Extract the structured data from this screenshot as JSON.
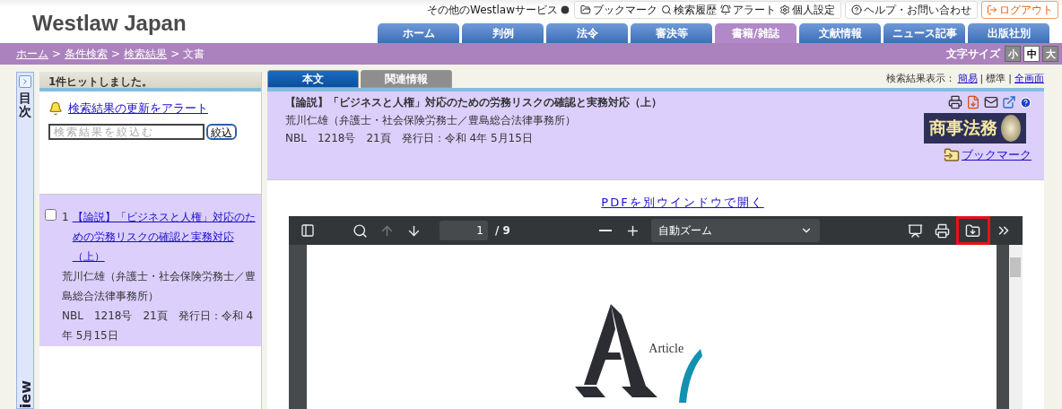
{
  "header": {
    "logo": "Westlaw Japan",
    "utility_links": [
      {
        "kind": "services",
        "label": "その他のWestlawサービス"
      },
      {
        "kind": "bookmark",
        "label": "ブックマーク"
      },
      {
        "kind": "history",
        "label": "検索履歴"
      },
      {
        "kind": "alert",
        "label": "アラート"
      },
      {
        "kind": "settings",
        "label": "個人設定"
      },
      {
        "kind": "help",
        "label": "ヘルプ・お問い合わせ"
      },
      {
        "kind": "logout",
        "label": "ログアウト"
      }
    ],
    "tabs": [
      {
        "label": "ホーム",
        "selected": false
      },
      {
        "label": "判例",
        "selected": false
      },
      {
        "label": "法令",
        "selected": false
      },
      {
        "label": "審決等",
        "selected": false
      },
      {
        "label": "書籍/雑誌",
        "selected": true
      },
      {
        "label": "文献情報",
        "selected": false
      },
      {
        "label": "ニュース記事",
        "selected": false
      },
      {
        "label": "出版社別",
        "selected": false
      }
    ]
  },
  "breadcrumb": {
    "separator": ">",
    "items": [
      {
        "label": "ホーム",
        "link": true
      },
      {
        "label": "条件検索",
        "link": true
      },
      {
        "label": "検索結果",
        "link": true
      },
      {
        "label": "文書",
        "link": false
      }
    ]
  },
  "font_size": {
    "label": "文字サイズ",
    "options": [
      {
        "label": "小",
        "selected": false
      },
      {
        "label": "中",
        "selected": true
      },
      {
        "label": "大",
        "selected": false
      }
    ]
  },
  "side_strip": {
    "toc_label": "目次",
    "bottom_label": "iew"
  },
  "results_panel": {
    "hit_count": "1件ヒットしました。",
    "alert_link": "検索結果の更新をアラート",
    "filter": {
      "placeholder": "検索結果を絞込む"
    },
    "filter_button": "絞込",
    "results": [
      {
        "checked": false,
        "number": "1",
        "title": "【論説】「ビジネスと人権」対応のための労務リスクの確認と実務対応（上）",
        "author": "荒川仁雄（弁護士・社会保険労務士／豊島総合法律事務所）",
        "source": "NBL　1218号　21頁　発行日：令和 4年 5月15日"
      }
    ]
  },
  "document": {
    "tabs": [
      {
        "label": "本文",
        "selected": true
      },
      {
        "label": "関連情報",
        "selected": false
      }
    ],
    "view_label": "検索結果表示：",
    "view_separator": "|",
    "view_modes": [
      {
        "label": "簡易",
        "link": true
      },
      {
        "label": "標準",
        "link": false
      },
      {
        "label": "全画面",
        "link": true
      }
    ],
    "title": "【論説】「ビジネスと人権」対応のための労務リスクの確認と実務対応（上）",
    "author": "荒川仁雄（弁護士・社会保険労務士／豊島総合法律事務所）",
    "source": "NBL　1218号　21頁　発行日：令和 4年 5月15日",
    "publisher_logo": "商事法務",
    "bookmark_link": "ブックマーク",
    "pdf_link": "PDFを別ウインドウで開く"
  },
  "pdf_viewer": {
    "page": "1",
    "total": "/ 9",
    "zoom": "自動ズーム",
    "right_tools": [
      {
        "kind": "presentation",
        "highlighted": false
      },
      {
        "kind": "print",
        "highlighted": false
      },
      {
        "kind": "download",
        "highlighted": true
      },
      {
        "kind": "more",
        "highlighted": false
      }
    ],
    "page_text": "Article"
  }
}
